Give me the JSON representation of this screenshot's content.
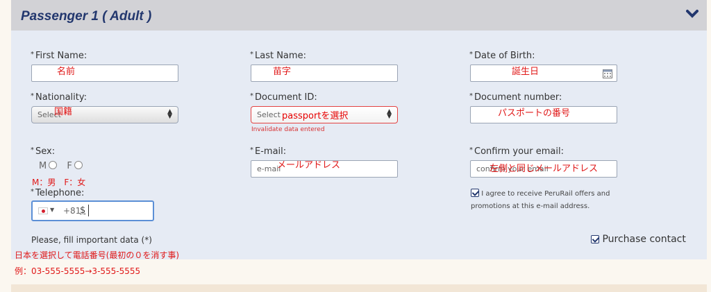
{
  "header": {
    "title": "Passenger 1 ( Adult )",
    "collapse_icon": "chevron-down-icon"
  },
  "fields": {
    "first_name": {
      "label": "First Name:",
      "value": "",
      "star": "*"
    },
    "last_name": {
      "label": "Last Name:",
      "value": "",
      "star": "*"
    },
    "date_of_birth": {
      "label": "Date of Birth:",
      "value": "",
      "star": "*",
      "icon": "calendar-icon"
    },
    "nationality": {
      "label": "Nationality:",
      "selected": "Select",
      "star": "*"
    },
    "document_id": {
      "label": "Document ID:",
      "selected": "Select",
      "star": "*",
      "error": "Invalidate data entered"
    },
    "document_number": {
      "label": "Document number:",
      "value": "",
      "star": "*"
    },
    "sex": {
      "label": "Sex:",
      "star": "*",
      "options": [
        "M",
        "F"
      ]
    },
    "email": {
      "label": "E-mail:",
      "placeholder": "e-mail",
      "star": "*"
    },
    "confirm_email": {
      "label": "Confirm your email:",
      "placeholder": "confirm your email",
      "star": "*"
    },
    "telephone": {
      "label": "Telephone:",
      "star": "*",
      "country_code": "+81",
      "value": "$"
    }
  },
  "consent": {
    "text_line1": "I agree to receive PeruRail offers and",
    "text_line2": "promotions at this e-mail address.",
    "checked": true
  },
  "notice": "Please, fill important data (*)",
  "purchase_contact": {
    "label": "Purchase contact",
    "checked": true
  },
  "annotations": {
    "first_name": "名前",
    "last_name": "苗字",
    "dob": "誕生日",
    "nationality": "国籍",
    "document_id": "passportを選択",
    "document_number": "パスポートの番号",
    "sex": "M：男　F：女",
    "email": "メールアドレス",
    "confirm_email": "左側と同じメールアドレス",
    "phone_1": "日本を選択して電話番号(最初の０を消す事)",
    "phone_2": "例：03-555-5555→3-555-5555"
  },
  "colors": {
    "header_text": "#22376e",
    "annotation": "#e01818",
    "error": "#e34242"
  }
}
